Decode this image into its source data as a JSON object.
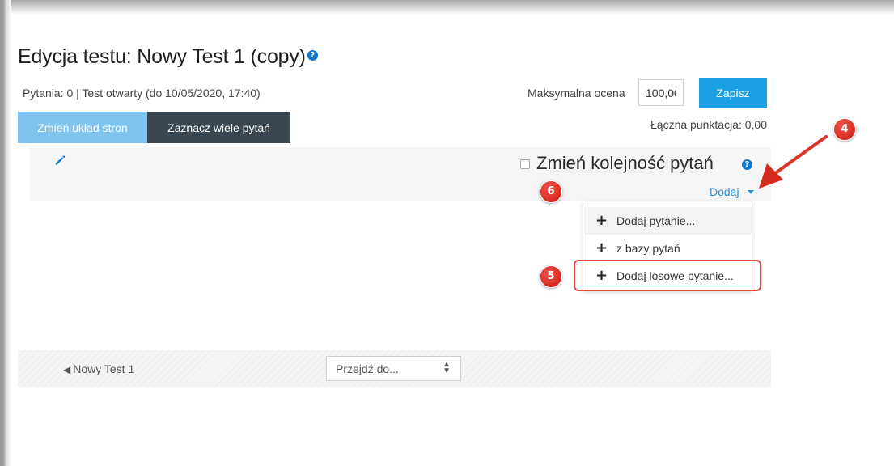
{
  "page": {
    "title": "Edycja testu: Nowy Test 1 (copy)",
    "status": "Pytania: 0 | Test otwarty (do 10/05/2020, 17:40)"
  },
  "grade": {
    "label": "Maksymalna ocena",
    "value": "100,00",
    "save_label": "Zapisz",
    "total": "Łączna punktacja: 0,00"
  },
  "toolbar": {
    "repaginate_label": "Zmień układ stron",
    "select_multiple_label": "Zaznacz wiele pytań"
  },
  "section": {
    "shuffle_label": "Zmień kolejność pytań",
    "add_label": "Dodaj"
  },
  "add_menu": {
    "items": [
      {
        "label": "Dodaj pytanie..."
      },
      {
        "label": "z bazy pytań"
      },
      {
        "label": "Dodaj losowe pytanie..."
      }
    ]
  },
  "annotations": {
    "badges": [
      "4",
      "5",
      "6"
    ]
  },
  "navigation": {
    "prev_activity": "Nowy Test 1",
    "jump_to_placeholder": "Przejdź do..."
  },
  "icons": {
    "help": "question-circle-icon",
    "edit": "pencil-icon",
    "add": "plus-icon",
    "prev": "triangle-left-icon",
    "select": "up-down-caret-icon"
  },
  "colors": {
    "primary": "#1aa0e6",
    "primary_light": "#7fc4ee",
    "dark_button": "#3a4750",
    "link": "#2f8fd8",
    "annotation_red": "#e0453a"
  }
}
